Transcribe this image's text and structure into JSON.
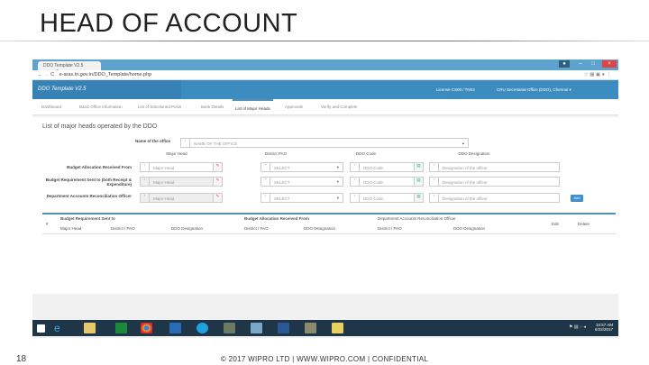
{
  "slide": {
    "title": "HEAD OF ACCOUNT",
    "page_number": "18",
    "footer": "© 2017 WIPRO LTD | WWW.WIPRO.COM | CONFIDENTIAL"
  },
  "browser": {
    "tab_title": "DDO Template V2.5",
    "tab_close": "×",
    "url": "e-aras.tn.gov.in/DDO_Template/home.php",
    "win_min": "–",
    "win_max": "□",
    "win_close": "×"
  },
  "app": {
    "brand": "DDO Template V2.5",
    "license": "License CS00 / TN03",
    "user": "CRU Secretariat Office (DDO), Chennai ▾"
  },
  "nav": [
    "Dashboard",
    "Basic Office Information",
    "List of Sanctioned Posts",
    "Bank Details",
    "List of Major Heads",
    "Approvals",
    "Verify and Complete"
  ],
  "content": {
    "heading": "List of major heads operated by the DDO",
    "office_label": "Name of the office",
    "office_value": "NAME OF THE OFFICE",
    "columns": [
      "Major Head",
      "District PAO",
      "DDO Code",
      "DDO Designation"
    ],
    "rows": [
      {
        "label": "Budget Allocation Received From",
        "major_head": "Major Head",
        "pao": "SELECT",
        "ddo_code": "DDO Code",
        "designation": "Designation of the officer"
      },
      {
        "label": "Budget Requirement Sent to (both Receipt & Expenditure)",
        "major_head": "Major Head",
        "pao": "SELECT",
        "ddo_code": "DDO Code",
        "designation": "Designation of the officer"
      },
      {
        "label": "Department Accounts Reconciliation Officer",
        "major_head": "Major Head",
        "pao": "SELECT",
        "ddo_code": "DDO Code",
        "designation": "Designation of the officer"
      }
    ],
    "add_button": "Add",
    "table": {
      "hash": "#",
      "groups": [
        "Budget Requirement Sent to",
        "Budget Allocation Received From",
        "Department Accounts Reconciliation Officer"
      ],
      "sub": [
        "Major Head",
        "District / PAO",
        "DDO Designation",
        "District / PAO",
        "DDO Designation",
        "District / PAO",
        "DDO Designation"
      ],
      "edit": "Edit",
      "delete": "Delete"
    }
  },
  "taskbar": {
    "time": "10:57 AM",
    "date": "6/22/2017"
  }
}
